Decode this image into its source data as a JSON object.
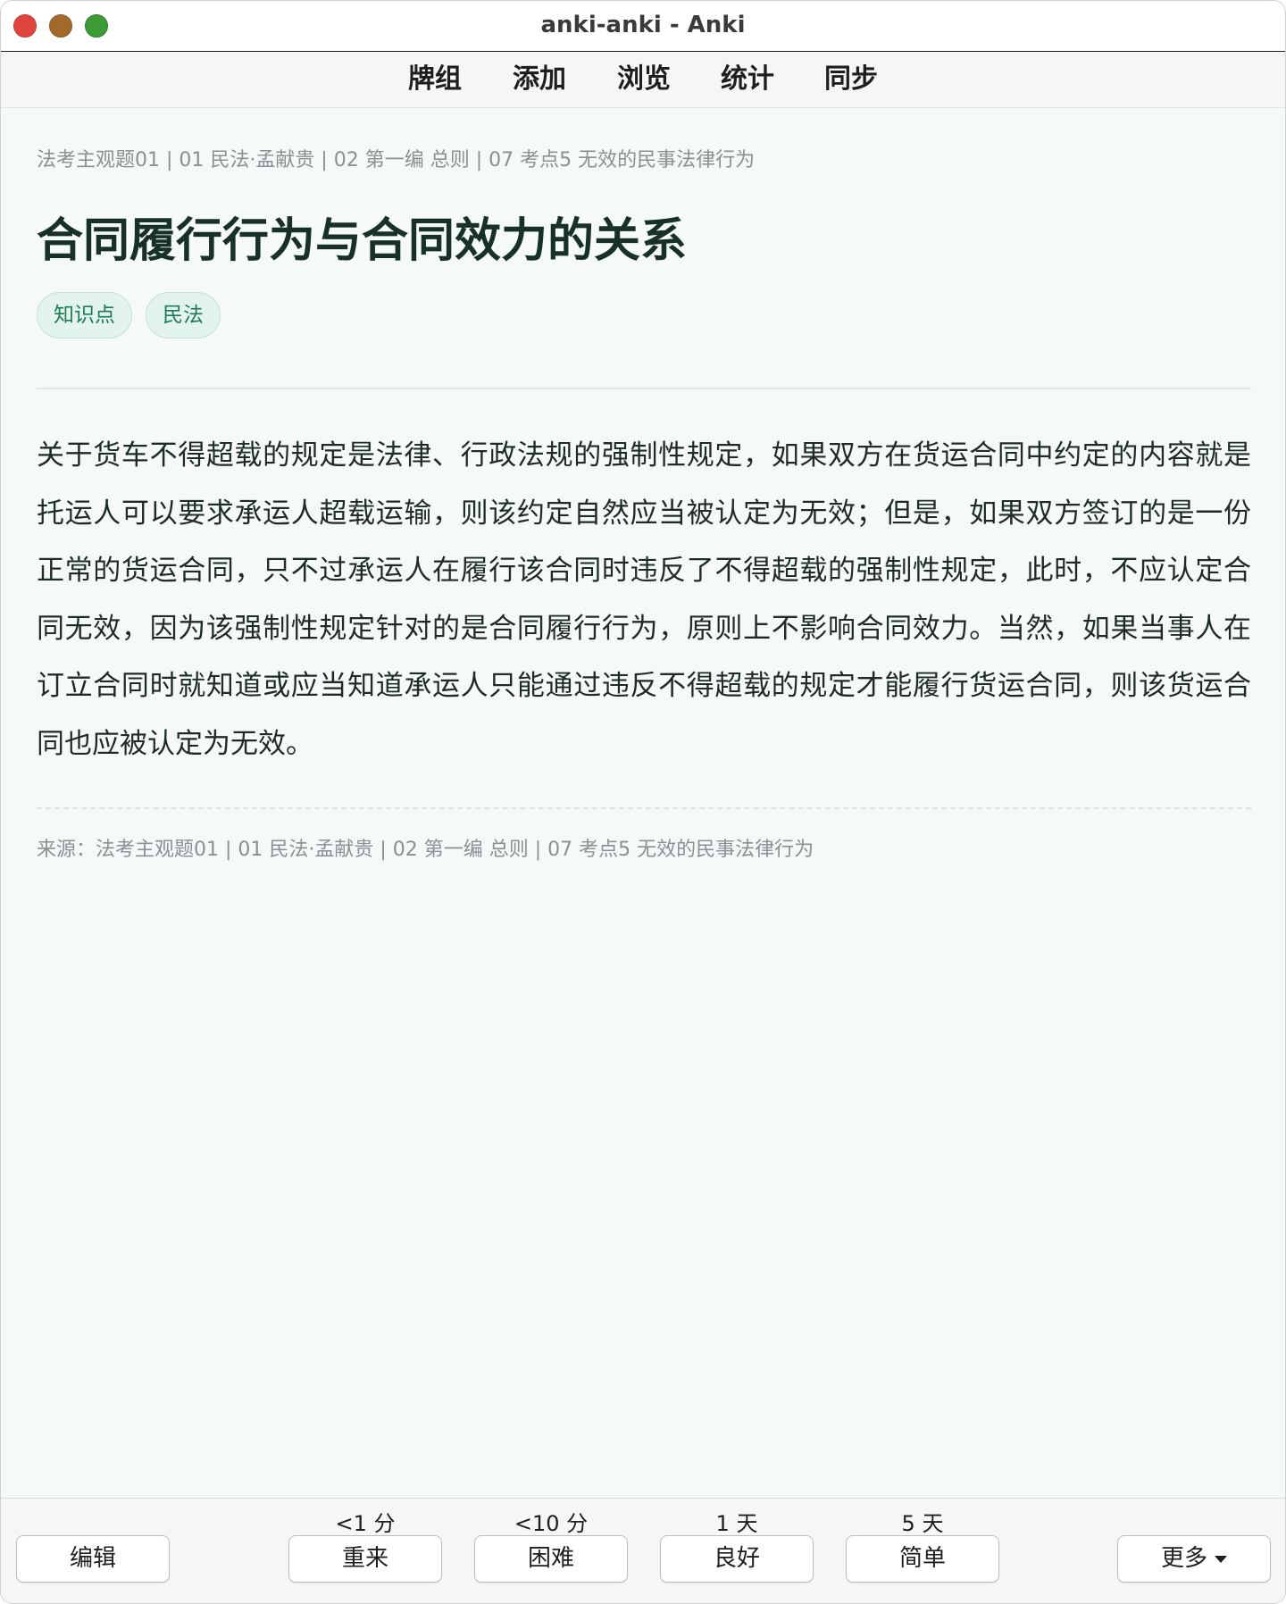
{
  "window": {
    "title": "anki-anki - Anki"
  },
  "toolbar": {
    "items": [
      "牌组",
      "添加",
      "浏览",
      "统计",
      "同步"
    ]
  },
  "card": {
    "breadcrumb": "法考主观题01 | 01 民法·孟献贵 | 02 第一编 总则 | 07 考点5 无效的民事法律行为",
    "title": "合同履行行为与合同效力的关系",
    "tags": [
      "知识点",
      "民法"
    ],
    "body": "关于货车不得超载的规定是法律、行政法规的强制性规定，如果双方在货运合同中约定的内容就是托运人可以要求承运人超载运输，则该约定自然应当被认定为无效；但是，如果双方签订的是一份正常的货运合同，只不过承运人在履行该合同时违反了不得超载的强制性规定，此时，不应认定合同无效，因为该强制性规定针对的是合同履行行为，原则上不影响合同效力。当然，如果当事人在订立合同时就知道或应当知道承运人只能通过违反不得超载的规定才能履行货运合同，则该货运合同也应被认定为无效。",
    "source": "来源：法考主观题01 | 01 民法·孟献贵 | 02 第一编 总则 | 07 考点5 无效的民事法律行为"
  },
  "bottombar": {
    "edit_label": "编辑",
    "answers": [
      {
        "interval": "<1 分",
        "label": "重来"
      },
      {
        "interval": "<10 分",
        "label": "困难"
      },
      {
        "interval": "1 天",
        "label": "良好"
      },
      {
        "interval": "5 天",
        "label": "简单"
      }
    ],
    "more_label": "更多"
  },
  "colors": {
    "title": "#17302a",
    "tag_text": "#1f7a55",
    "tag_bg": "#e3f4ee",
    "muted": "#8a9093",
    "close": "#e0443e",
    "minimize": "#a26a2a",
    "zoom": "#3c9a37"
  }
}
